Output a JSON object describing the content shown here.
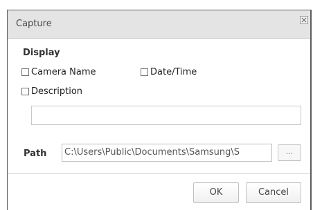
{
  "dialog": {
    "title": "Capture",
    "close_icon": "close-icon"
  },
  "display": {
    "label": "Display",
    "options": {
      "camera_name": {
        "label": "Camera Name",
        "checked": false
      },
      "date_time": {
        "label": "Date/Time",
        "checked": false
      },
      "description": {
        "label": "Description",
        "checked": false
      }
    },
    "description_value": ""
  },
  "path": {
    "label": "Path",
    "value": "C:\\Users\\Public\\Documents\\Samsung\\S",
    "browse_label": "..."
  },
  "buttons": {
    "ok": "OK",
    "cancel": "Cancel"
  }
}
